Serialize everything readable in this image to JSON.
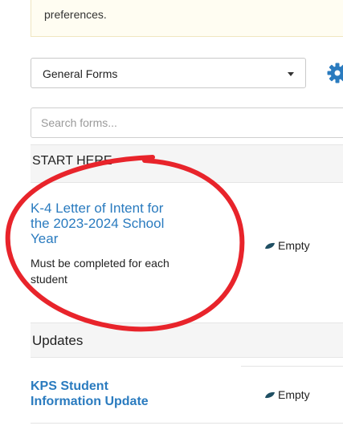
{
  "notice": {
    "text": "preferences."
  },
  "form_selector": {
    "selected": "General Forms"
  },
  "search": {
    "placeholder": "Search forms..."
  },
  "sections": [
    {
      "title": "START HERE",
      "forms": [
        {
          "title_line1": "K-4 Letter of Intent for",
          "title_line2": "the 2023-2024 School",
          "title_line3": "Year",
          "desc_line1": "Must be completed for each",
          "desc_line2": "student",
          "status": "Empty"
        }
      ]
    },
    {
      "title": "Updates",
      "forms": [
        {
          "title_line1": "KPS Student",
          "title_line2": "Information Update",
          "status": "Empty"
        }
      ]
    }
  ],
  "colors": {
    "link": "#2a7bbf",
    "gear": "#2a7bbf",
    "leaf": "#1f4f63",
    "annotation": "#e8242b"
  }
}
